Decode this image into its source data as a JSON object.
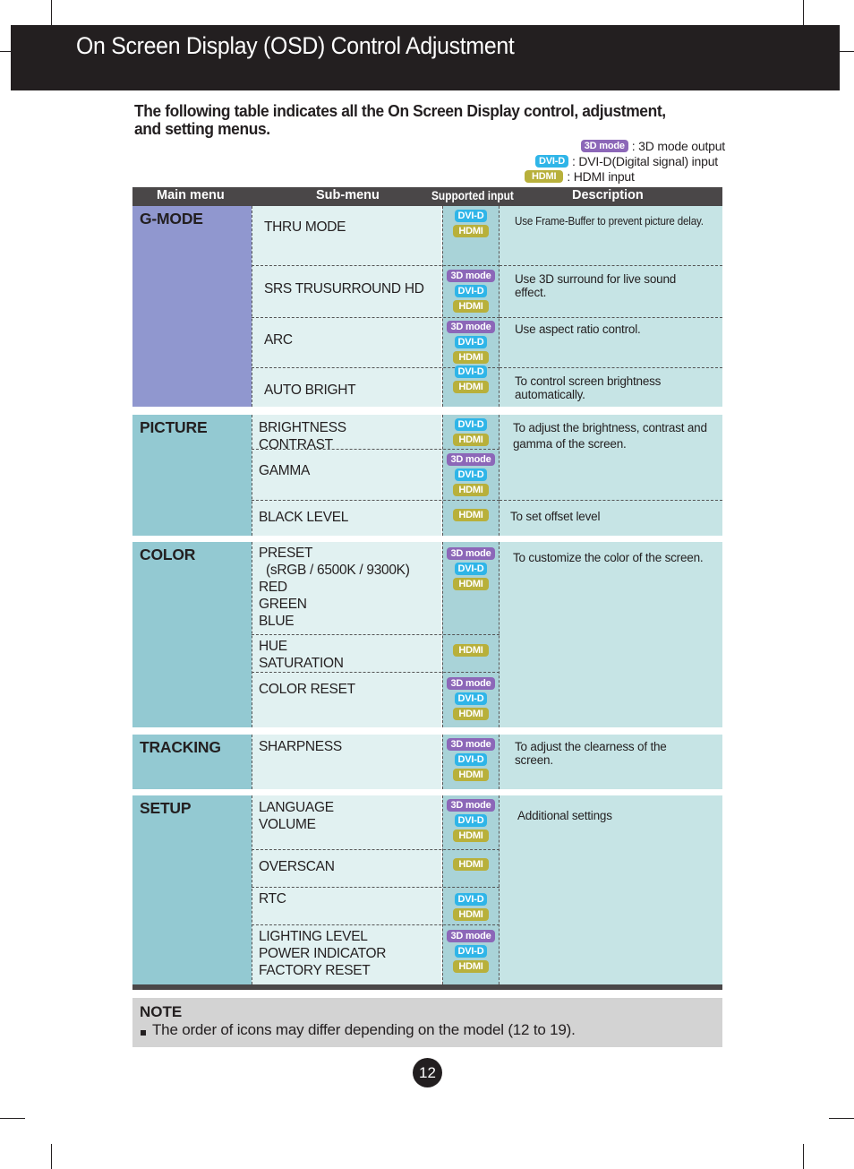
{
  "header": {
    "title": "On Screen Display (OSD) Control Adjustment"
  },
  "intro": "The following table indicates all the On Screen Display control, adjustment, and setting menus.",
  "legend": [
    {
      "tag": "3D mode",
      "kind": "3d",
      "text": ": 3D mode output"
    },
    {
      "tag": "DVI-D",
      "kind": "dvi",
      "text": ": DVI-D(Digital signal) input"
    },
    {
      "tag": "HDMI",
      "kind": "hdmi",
      "text": ": HDMI input"
    }
  ],
  "colors": {
    "tag_3d": "#8c67b8",
    "tag_dvi": "#2fb5e8",
    "tag_hdmi": "#b8b03b",
    "gmode_bg": "#9097cf",
    "menu_bg": "#93c9d2",
    "header_bg": "#231f20",
    "table_head_bg": "#4a4748"
  },
  "table": {
    "headers": {
      "main": "Main menu",
      "sub": "Sub-menu",
      "input": "Supported input",
      "desc": "Description"
    },
    "tag_labels": {
      "3d": "3D mode",
      "dvi": "DVI-D",
      "hdmi": "HDMI"
    },
    "groups": [
      {
        "main": "G-MODE",
        "rows": [
          {
            "sub": "THRU MODE",
            "tags": [
              "dvi",
              "hdmi"
            ],
            "desc": "Use Frame-Buffer to prevent picture delay."
          },
          {
            "sub": "SRS TRUSURROUND HD",
            "tags": [
              "3d",
              "dvi",
              "hdmi"
            ],
            "desc": "Use 3D surround for live sound effect."
          },
          {
            "sub": "ARC",
            "tags": [
              "3d",
              "dvi",
              "hdmi"
            ],
            "desc": "Use aspect ratio control."
          },
          {
            "sub": "AUTO BRIGHT",
            "tags": [
              "dvi",
              "hdmi"
            ],
            "desc": "To control screen brightness automatically."
          }
        ]
      },
      {
        "main": "PICTURE",
        "rows": [
          {
            "sub": "BRIGHTNESS\nCONTRAST",
            "tags": [
              "dvi",
              "hdmi"
            ],
            "desc": "To adjust the brightness, contrast and gamma of the screen."
          },
          {
            "sub": "GAMMA",
            "tags": [
              "3d",
              "dvi",
              "hdmi"
            ],
            "desc": ""
          },
          {
            "sub": "BLACK LEVEL",
            "tags": [
              "hdmi"
            ],
            "desc": "To set offset level"
          }
        ]
      },
      {
        "main": "COLOR",
        "rows": [
          {
            "sub": "PRESET\n  (sRGB / 6500K / 9300K)\nRED\nGREEN\nBLUE",
            "tags": [
              "3d",
              "dvi",
              "hdmi"
            ],
            "desc": "To customize the color of the screen."
          },
          {
            "sub": "HUE\nSATURATION",
            "tags": [
              "hdmi"
            ],
            "desc": ""
          },
          {
            "sub": "COLOR RESET",
            "tags": [
              "3d",
              "dvi",
              "hdmi"
            ],
            "desc": ""
          }
        ]
      },
      {
        "main": "TRACKING",
        "rows": [
          {
            "sub": "SHARPNESS",
            "tags": [
              "3d",
              "dvi",
              "hdmi"
            ],
            "desc": "To adjust the clearness of the screen."
          }
        ]
      },
      {
        "main": "SETUP",
        "rows": [
          {
            "sub": "LANGUAGE\nVOLUME",
            "tags": [
              "3d",
              "dvi",
              "hdmi"
            ],
            "desc": "Additional settings"
          },
          {
            "sub": "OVERSCAN",
            "tags": [
              "hdmi"
            ],
            "desc": ""
          },
          {
            "sub": "RTC",
            "tags": [
              "dvi",
              "hdmi"
            ],
            "desc": ""
          },
          {
            "sub": "LIGHTING LEVEL\nPOWER INDICATOR\nFACTORY RESET",
            "tags": [
              "3d",
              "dvi",
              "hdmi"
            ],
            "desc": ""
          }
        ]
      }
    ]
  },
  "note": {
    "title": "NOTE",
    "text": "The order of icons may differ depending on the model (12 to 19)."
  },
  "page_number": "12"
}
